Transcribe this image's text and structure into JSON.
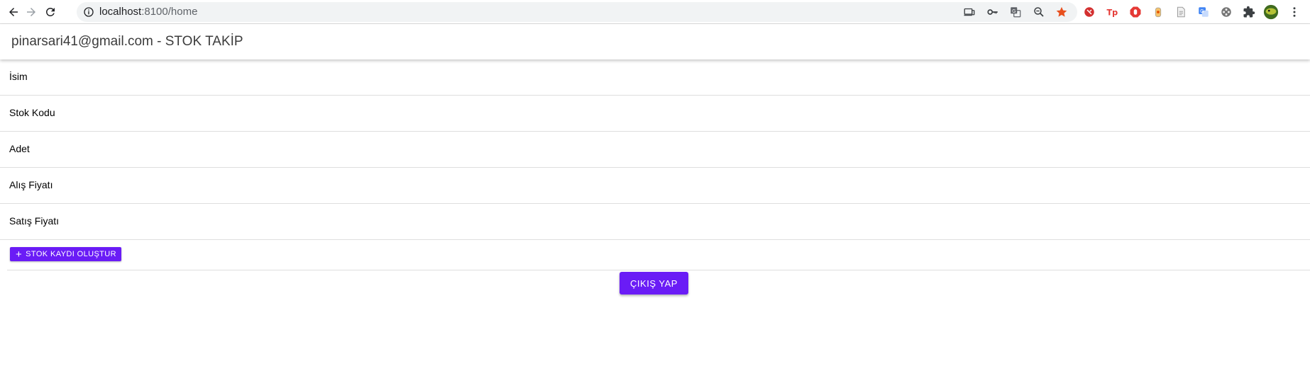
{
  "browser": {
    "url_host": "localhost",
    "url_path": ":8100/home",
    "extensions": [
      "cast-icon",
      "key-icon",
      "translate-icon",
      "zoom-out-icon",
      "star-icon",
      "ext-red-icon",
      "ext-tp-icon",
      "ext-stop-icon",
      "ext-bottle-icon",
      "ext-doc-icon",
      "ext-translate-blue-icon",
      "ext-film-icon",
      "puzzle-icon",
      "profile-avatar-icon",
      "menu-dots-icon"
    ]
  },
  "header": {
    "title": "pinarsari41@gmail.com - STOK TAKİP"
  },
  "form": {
    "fields": [
      {
        "label": "İsim",
        "value": ""
      },
      {
        "label": "Stok Kodu",
        "value": ""
      },
      {
        "label": "Adet",
        "value": ""
      },
      {
        "label": "Alış Fiyatı",
        "value": ""
      },
      {
        "label": "Satış Fiyatı",
        "value": ""
      }
    ],
    "create_label": "STOK KAYDI OLUŞTUR",
    "create_icon": "plus-icon"
  },
  "logout_label": "ÇIKIŞ YAP",
  "colors": {
    "primary": "#6a1cf6",
    "star": "#e8501e"
  }
}
